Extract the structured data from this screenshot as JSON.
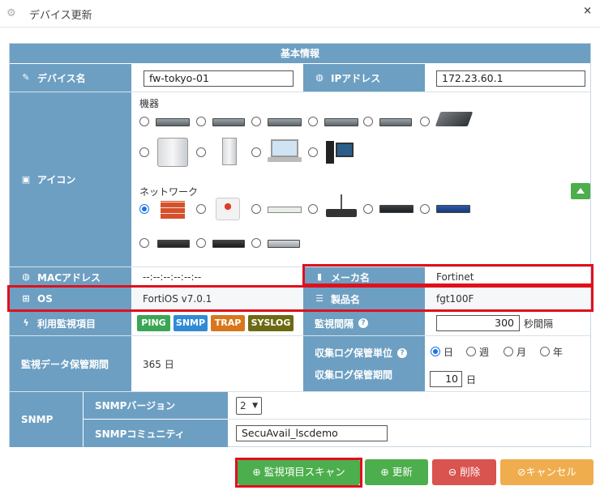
{
  "window": {
    "title": "デバイス更新",
    "close": "×"
  },
  "section": {
    "header": "基本情報"
  },
  "device_name": {
    "label": "デバイス名",
    "value": "fw-tokyo-01"
  },
  "ip": {
    "label": "IPアドレス",
    "value": "172.23.60.1"
  },
  "icon": {
    "label": "アイコン",
    "group_equipment": "機器",
    "group_network": "ネットワーク"
  },
  "mac": {
    "label": "MACアドレス",
    "value": "--:--:--:--:--:--"
  },
  "maker": {
    "label": "メーカ名",
    "value": "Fortinet"
  },
  "os": {
    "label": "OS",
    "value": "FortiOS v7.0.1"
  },
  "product": {
    "label": "製品名",
    "value": "fgt100F"
  },
  "monitor_items": {
    "label": "利用監視項目",
    "tags": [
      "PING",
      "SNMP",
      "TRAP",
      "SYSLOG"
    ]
  },
  "interval": {
    "label": "監視間隔",
    "value": "300",
    "unit": "秒間隔"
  },
  "retention": {
    "label": "監視データ保管期間",
    "value": "365 日"
  },
  "log_unit": {
    "label": "収集ログ保管単位",
    "options": [
      "日",
      "週",
      "月",
      "年"
    ],
    "selected": "日"
  },
  "log_period": {
    "label": "収集ログ保管期間",
    "value": "10",
    "unit": "日"
  },
  "snmp": {
    "label": "SNMP",
    "version_label": "SNMPバージョン",
    "version_value": "2",
    "community_label": "SNMPコミュニティ",
    "community_value": "SecuAvail_lscdemo"
  },
  "buttons": {
    "scan": "監視項目スキャン",
    "update": "更新",
    "delete": "削除",
    "cancel": "キャンセル"
  },
  "colors": {
    "header": "#6d9fc2",
    "ping": "#3aa655",
    "snmp": "#2f8bd6",
    "trap": "#d9761c",
    "syslog": "#6d6a14",
    "highlight": "#e0101c"
  }
}
